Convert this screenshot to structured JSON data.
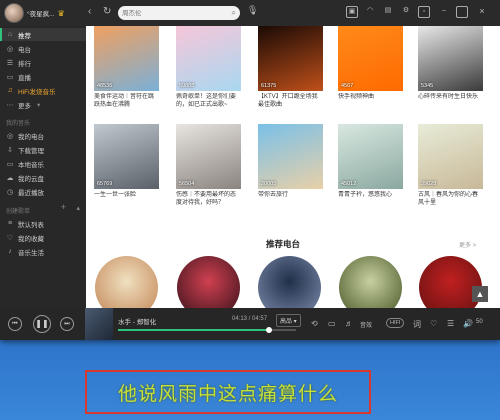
{
  "titlebar": {
    "username": "°夜星疯...",
    "search_placeholder": "周杰伦"
  },
  "sidebar": {
    "main_items": [
      {
        "label": "推荐",
        "icon": "home-icon",
        "active": true
      },
      {
        "label": "电台",
        "icon": "radio-icon"
      },
      {
        "label": "排行",
        "icon": "chart-icon"
      },
      {
        "label": "直播",
        "icon": "live-icon"
      },
      {
        "label": "HiFi发烧音乐",
        "icon": "hifi-icon"
      },
      {
        "label": "更多",
        "icon": "more-icon"
      }
    ],
    "my_music_heading": "我的音乐",
    "my_music_items": [
      {
        "label": "我的电台",
        "icon": "radio-icon"
      },
      {
        "label": "下载管理",
        "icon": "download-icon"
      },
      {
        "label": "本地音乐",
        "icon": "folder-icon"
      },
      {
        "label": "我的云盘",
        "icon": "cloud-icon"
      },
      {
        "label": "最近播放",
        "icon": "clock-icon"
      }
    ],
    "created_heading": "创建歌单",
    "created_items": [
      {
        "label": "默认列表",
        "icon": "list-icon"
      },
      {
        "label": "我的收藏",
        "icon": "heart-icon"
      },
      {
        "label": "音乐生活",
        "icon": "music-icon"
      }
    ]
  },
  "playlists_row1": [
    {
      "count": "48536",
      "caption": "美食伴运动｜音符在跳跃热血在沸腾",
      "colors": [
        "#f0a060",
        "#7ab0d8"
      ]
    },
    {
      "count": "59888",
      "caption": "佩奇歌单！这是你们要的，如已正式出歌~",
      "colors": [
        "#f7c6d9",
        "#a8d8f0"
      ]
    },
    {
      "count": "61375",
      "caption": "【KTV】开口跪全场我最佳歌曲",
      "colors": [
        "#1a0a05",
        "#c0501a"
      ]
    },
    {
      "count": "4567",
      "caption": "快手视频神曲",
      "colors": [
        "#ff8a1a",
        "#ff6a00"
      ]
    },
    {
      "count": "5345",
      "caption": "心碎传来有时生日快乐",
      "colors": [
        "#e8e8e8",
        "#3a3a3a"
      ]
    }
  ],
  "playlists_row2": [
    {
      "count": "65769",
      "caption": "一生一世一张脸",
      "colors": [
        "#c0c8d0",
        "#5a6068"
      ]
    },
    {
      "count": "56504",
      "caption": "伤感｜不要用最坏的态度对待我，好吗？",
      "colors": [
        "#e8e4e0",
        "#8a8480"
      ]
    },
    {
      "count": "20005",
      "caption": "带你去旅行",
      "colors": [
        "#7ac0e8",
        "#e8d0a8"
      ]
    },
    {
      "count": "45012",
      "caption": "青青子衿，悠悠我心",
      "colors": [
        "#d8e8e0",
        "#8aa8a0"
      ]
    },
    {
      "count": "39028",
      "caption": "古风｜春风为你的心春风十里",
      "colors": [
        "#e8ecd8",
        "#c8b898"
      ]
    }
  ],
  "radio_section": {
    "title": "推荐电台",
    "more": "更多 >",
    "stations": [
      {
        "colors": [
          "#f0e0c0",
          "#c08050"
        ]
      },
      {
        "colors": [
          "#d04050",
          "#301018"
        ]
      },
      {
        "colors": [
          "#20304a",
          "#8090b0"
        ]
      },
      {
        "colors": [
          "#c8d0a0",
          "#405020"
        ]
      },
      {
        "colors": [
          "#c02020",
          "#601010"
        ]
      }
    ]
  },
  "player": {
    "song": "水手 - 郑智化",
    "time": "04:13 / 04:57",
    "progress": 0.85,
    "quality": "高品 ▾",
    "effect": "HIFI",
    "volume": "50"
  },
  "lyric": "他说风雨中这点痛算什么"
}
